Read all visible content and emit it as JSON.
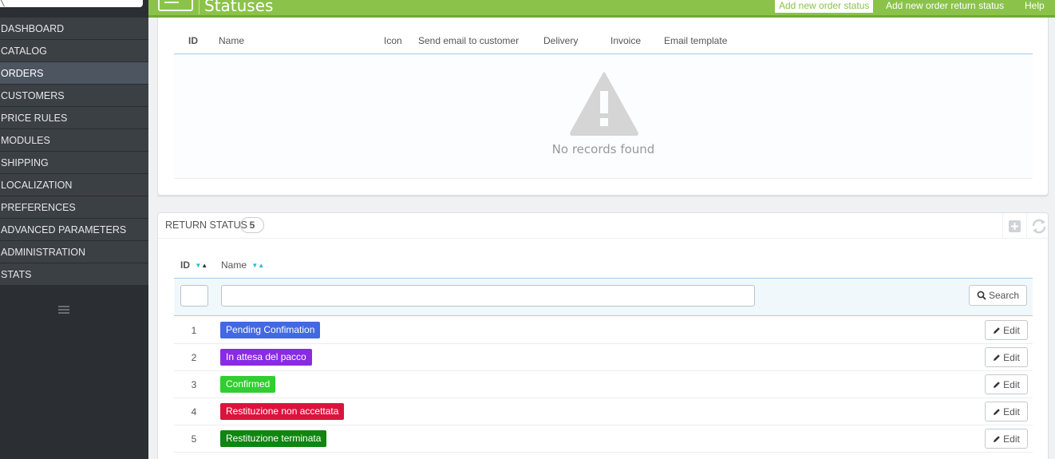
{
  "header": {
    "title": "Statuses",
    "add_order_status": "Add new order status",
    "add_return_status": "Add new order return status",
    "help": "Help"
  },
  "sidebar": {
    "items": [
      {
        "label": "DASHBOARD"
      },
      {
        "label": "CATALOG"
      },
      {
        "label": "ORDERS",
        "active": true
      },
      {
        "label": "CUSTOMERS"
      },
      {
        "label": "PRICE RULES"
      },
      {
        "label": "MODULES"
      },
      {
        "label": "SHIPPING"
      },
      {
        "label": "LOCALIZATION"
      },
      {
        "label": "PREFERENCES"
      },
      {
        "label": "ADVANCED PARAMETERS"
      },
      {
        "label": "ADMINISTRATION"
      },
      {
        "label": "STATS"
      }
    ]
  },
  "order_status_table": {
    "columns": [
      "ID",
      "Name",
      "Icon",
      "Send email to customer",
      "Delivery",
      "Invoice",
      "Email template"
    ],
    "empty_message": "No records found"
  },
  "return_status": {
    "title": "RETURN STATUS",
    "count": "5",
    "columns": {
      "id": "ID",
      "name": "Name"
    },
    "search_label": "Search",
    "edit_label": "Edit",
    "rows": [
      {
        "id": "1",
        "name": "Pending Confimation",
        "color": "#4169e1"
      },
      {
        "id": "2",
        "name": "In attesa del pacco",
        "color": "#8a2be2"
      },
      {
        "id": "3",
        "name": "Confirmed",
        "color": "#32cd32"
      },
      {
        "id": "4",
        "name": "Restituzione non accettata",
        "color": "#dc143c"
      },
      {
        "id": "5",
        "name": "Restituzione terminata",
        "color": "#108510"
      }
    ]
  },
  "icons": {
    "warning": "warning-triangle-icon",
    "add": "plus-square-icon",
    "refresh": "refresh-icon",
    "search": "magnifier-icon",
    "edit": "pencil-icon",
    "menu": "hamburger-icon"
  },
  "colors": {
    "header_green": "#8bc34a",
    "sidebar_dark": "#2b2f33",
    "sort_accent": "#25b9d7"
  }
}
